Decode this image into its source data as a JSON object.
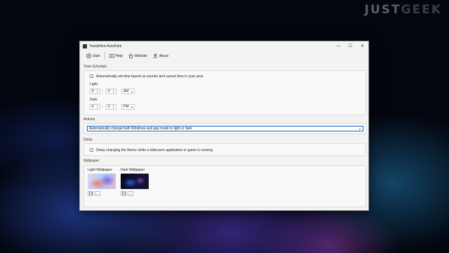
{
  "watermark": {
    "part1": "JUST",
    "part2": "GEEK"
  },
  "window": {
    "title": "TweakNow AutoDark",
    "controls": {
      "minimize": "—",
      "maximize": "☐",
      "close": "✕"
    }
  },
  "toolbar": {
    "start": "Start",
    "help": "Help",
    "website": "Website",
    "about": "About"
  },
  "time_schedule": {
    "section_label": "Time Schedule",
    "auto_checkbox_label": "Automatically set time based on sunrise and sunset time in your area",
    "auto_checked": false,
    "light": {
      "label": "Light",
      "hour": "8",
      "minute": "0",
      "period": "AM"
    },
    "dark": {
      "label": "Dark",
      "hour": "6",
      "minute": "0",
      "period": "PM"
    },
    "separator": ":"
  },
  "actions": {
    "section_label": "Actions",
    "selected": "Automatically change both Windows and app mode to light or dark"
  },
  "delay": {
    "section_label": "Delay",
    "checkbox_label": "Delay changing the theme while a fullscreen application or game is running.",
    "checked": false
  },
  "wallpaper": {
    "section_label": "Wallpaper",
    "light_label": "Light Wallpaper",
    "dark_label": "Dark Wallpaper",
    "browse_icon": "folder-icon",
    "clear_label": "—"
  }
}
